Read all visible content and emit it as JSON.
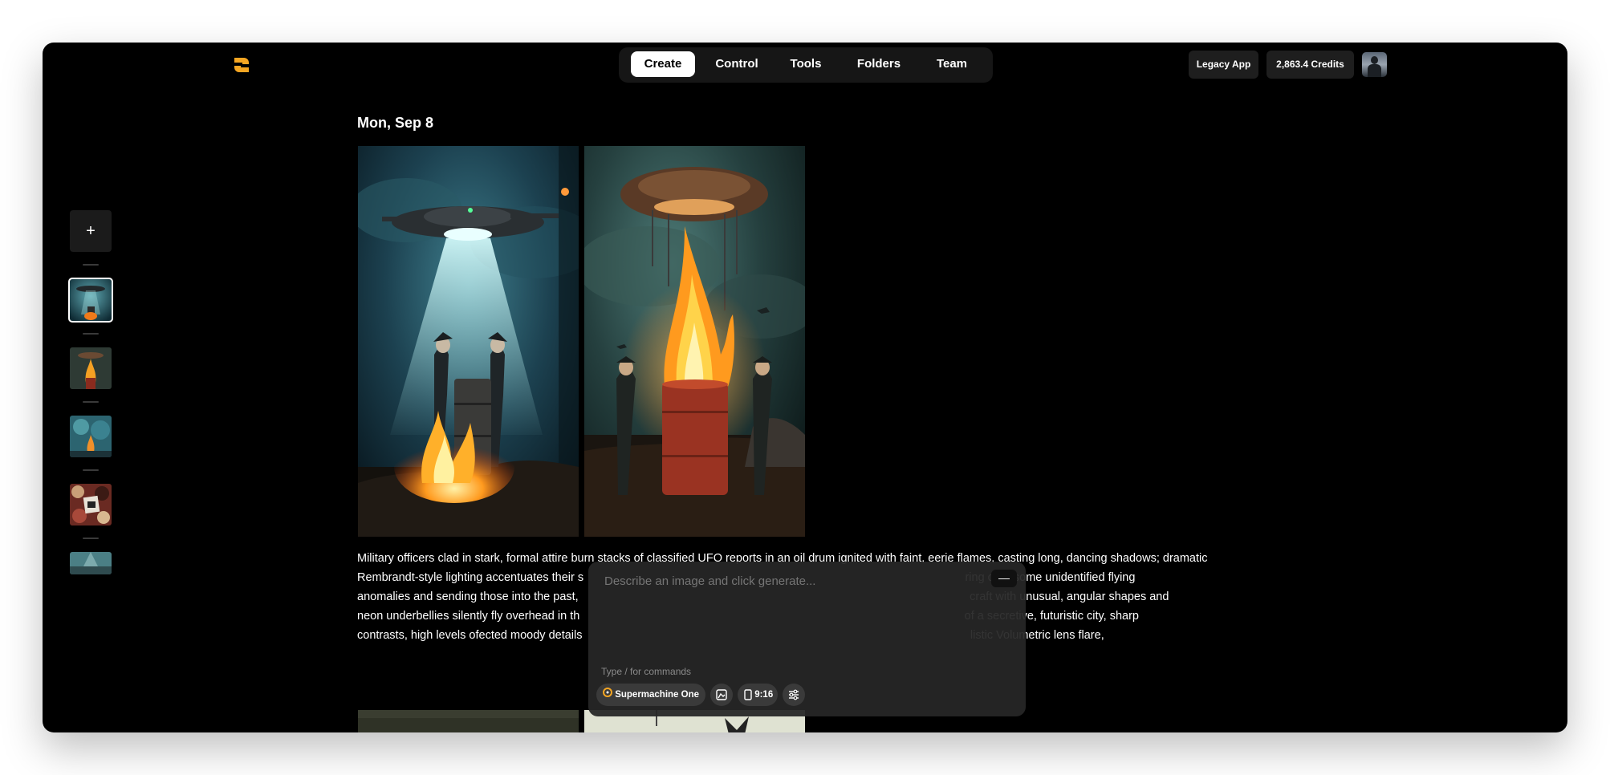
{
  "header": {
    "nav_tabs": [
      {
        "label": "Create",
        "active": true
      },
      {
        "label": "Control",
        "active": false
      },
      {
        "label": "Tools",
        "active": false
      },
      {
        "label": "Folders",
        "active": false
      },
      {
        "label": "Team",
        "active": false
      }
    ],
    "legacy_app_label": "Legacy App",
    "credits_label": "2,863.4 Credits",
    "logo_icon": "logo-icon",
    "accent_color": "#f5a623"
  },
  "sidebar": {
    "add_icon": "plus-icon",
    "thumbnails": [
      {
        "name": "thumbnail-ufo-beam",
        "selected": true
      },
      {
        "name": "thumbnail-ufo-fire",
        "selected": false
      },
      {
        "name": "thumbnail-ufo-teal",
        "selected": false
      },
      {
        "name": "thumbnail-collage",
        "selected": false
      },
      {
        "name": "thumbnail-partial",
        "selected": false
      }
    ]
  },
  "feed": {
    "date": "Mon, Sep 8",
    "prompt_lines": [
      "Military officers clad in stark, formal attire burn stacks of classified UFO reports in an oil drum ignited with faint, eerie flames, casting long, dancing shadows; dramatic",
      "Rembrandt-style lighting accentuates their s                                                                                                                      ring over some unidentified flying",
      "anomalies and sending those into the past,                                                                                                                         craft with unusual, angular shapes and",
      "neon underbellies silently fly overhead in th                                                                                                                       of a secretive, futuristic city, sharp",
      "contrasts, high levels ofected moody details                                                                                                                        listic Volumetric lens flare,"
    ]
  },
  "composer": {
    "placeholder": "Describe an image and click generate...",
    "hint": "Type / for commands",
    "model_label": "Supermachine One",
    "aspect_label": "9:16",
    "collapse_icon": "minus-icon",
    "style_icon": "image-style-icon",
    "settings_icon": "sliders-icon"
  }
}
